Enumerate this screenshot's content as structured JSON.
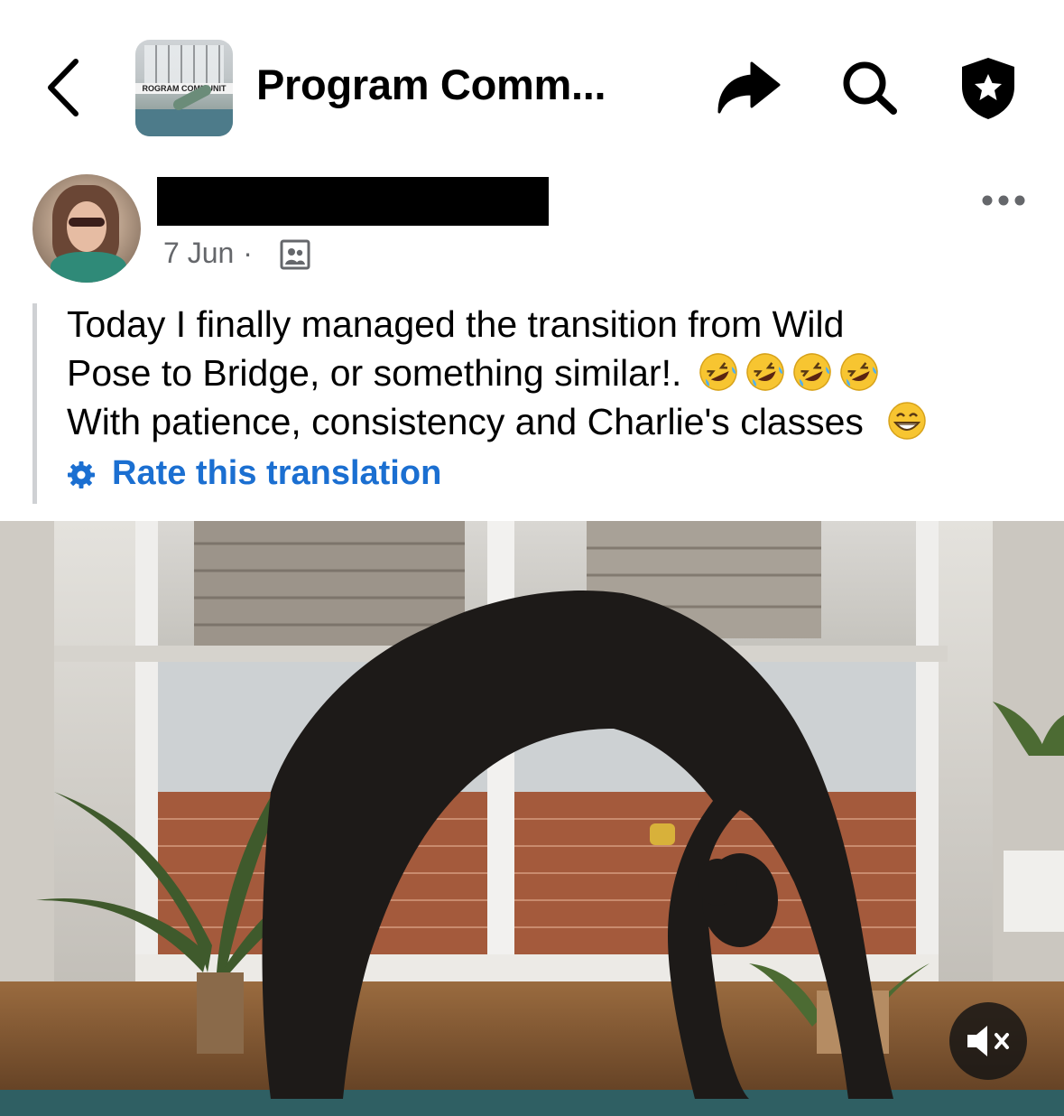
{
  "header": {
    "back_icon": "chevron-left-icon",
    "group_thumb_banner": "ROGRAM COMMUNIT",
    "title": "Program Comm...",
    "share_icon": "share-arrow-icon",
    "search_icon": "search-icon",
    "shield_icon": "shield-star-icon"
  },
  "post": {
    "author_redacted": true,
    "date": "7 Jun",
    "separator": "·",
    "audience_icon": "group-audience-icon",
    "more_icon": "more-dots-icon",
    "text_lines": [
      "Today I finally managed the transition from Wild",
      "Pose to Bridge, or something similar!.",
      "With patience, consistency and Charlie's classes"
    ],
    "emojis": {
      "line2": [
        "rolling-on-floor-laughing",
        "rolling-on-floor-laughing",
        "rolling-on-floor-laughing",
        "rolling-on-floor-laughing"
      ],
      "line3": [
        "grinning-face-with-smiling-eyes"
      ]
    },
    "translation_link": "Rate this translation",
    "translation_icon": "gear-icon"
  },
  "video": {
    "description": "",
    "mute_icon": "speaker-muted-icon"
  },
  "colors": {
    "link": "#1b6fd1",
    "meta": "#65676b",
    "quote_bar": "#cfd1d4"
  }
}
